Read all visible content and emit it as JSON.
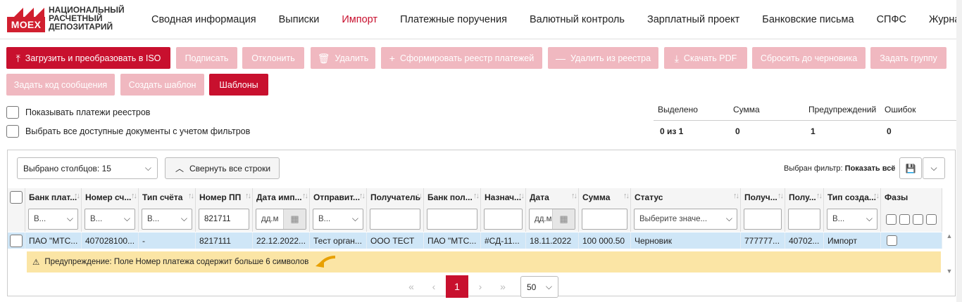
{
  "logo": {
    "box": "MOEX",
    "line1": "НАЦИОНАЛЬНЫЙ",
    "line2": "РАСЧЕТНЫЙ",
    "line3": "ДЕПОЗИТАРИЙ"
  },
  "nav": [
    "Сводная информация",
    "Выписки",
    "Импорт",
    "Платежные поручения",
    "Валютный контроль",
    "Зарплатный проект",
    "Банковские письма",
    "СПФС",
    "Журнал"
  ],
  "toolbar": {
    "upload": "Загрузить и преобразовать в ISO",
    "sign": "Подписать",
    "reject": "Отклонить",
    "delete": "Удалить",
    "form_registry": "Сформировать реестр платежей",
    "remove_registry": "Удалить из реестра",
    "download_pdf": "Скачать PDF",
    "reset_draft": "Сбросить до черновика",
    "set_group": "Задать группу",
    "set_msg_code": "Задать код сообщения",
    "create_template": "Создать шаблон",
    "templates": "Шаблоны"
  },
  "options": {
    "show_registry": "Показывать платежи реестров",
    "select_all": "Выбрать все доступные документы с учетом фильтров"
  },
  "stats": {
    "headers": [
      "Выделено",
      "Сумма",
      "Предупреждений",
      "Ошибок"
    ],
    "values": [
      "0 из 1",
      "0",
      "1",
      "0"
    ]
  },
  "grid": {
    "columns_select": "Выбрано столбцов: 15",
    "collapse": "Свернуть все строки",
    "filter_label": "Выбран фильтр:",
    "filter_value": "Показать всё",
    "headers": [
      "Банк плат...",
      "Номер сч...",
      "Тип счёта",
      "Номер ПП",
      "Дата имп...",
      "Отправит...",
      "Получатель",
      "Банк пол...",
      "Назнач...",
      "Дата",
      "Сумма",
      "Статус",
      "Получ...",
      "Полу...",
      "Тип созда...",
      "Фазы"
    ],
    "filters": {
      "bank": "В...",
      "account": "В...",
      "acc_type": "В...",
      "pp_number": "821711",
      "date_import": "дд.м",
      "sender": "В...",
      "date": "дд.м",
      "status": "Выберите значе...",
      "creation": "В..."
    },
    "row": [
      "ПАО \"МТС...",
      "407028100...",
      "-",
      "8217111",
      "22.12.2022...",
      "Тест орган...",
      "ООО ТЕСТ",
      "ПАО \"МТС...",
      "#СД-11...",
      "18.11.2022",
      "100 000.50",
      "Черновик",
      "777777...",
      "40702...",
      "Импорт",
      ""
    ],
    "warning": "Предупреждение: Поле Номер платежа содержит больше 6 символов"
  },
  "pager": {
    "current": "1",
    "page_size": "50"
  },
  "colors": {
    "accent": "#c8102e",
    "accent_disabled": "#f0b8c0",
    "row_selected": "#cfe6f7",
    "warning_bg": "#fbe5a5"
  }
}
